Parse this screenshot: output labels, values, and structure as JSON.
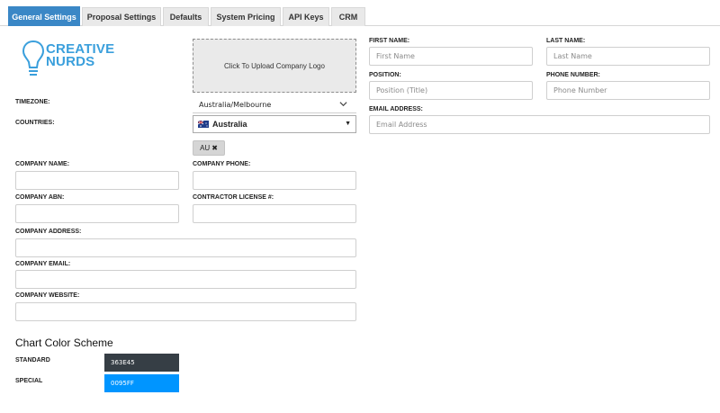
{
  "tabs": [
    {
      "label": "General Settings",
      "active": true
    },
    {
      "label": "Proposal Settings",
      "active": false
    },
    {
      "label": "Defaults",
      "active": false
    },
    {
      "label": "System Pricing",
      "active": false
    },
    {
      "label": "API Keys",
      "active": false
    },
    {
      "label": "CRM",
      "active": false
    }
  ],
  "logo": {
    "line1": "CREATIVE",
    "line2": "NURDS",
    "color": "#3a9fdc"
  },
  "upload_label": "Click To Upload Company Logo",
  "timezone": {
    "label": "TIMEZONE:",
    "value": "Australia/Melbourne"
  },
  "countries": {
    "label": "COUNTRIES:",
    "value": "Australia",
    "chips": [
      "AU"
    ]
  },
  "company": {
    "name_label": "COMPANY NAME:",
    "phone_label": "COMPANY PHONE:",
    "abn_label": "COMPANY ABN:",
    "license_label": "CONTRACTOR LICENSE #:",
    "address_label": "COMPANY ADDRESS:",
    "email_label": "COMPANY EMAIL:",
    "website_label": "COMPANY WEBSITE:"
  },
  "contact": {
    "first_name": {
      "label": "FIRST NAME:",
      "placeholder": "First Name"
    },
    "last_name": {
      "label": "LAST NAME:",
      "placeholder": "Last Name"
    },
    "position": {
      "label": "POSITION:",
      "placeholder": "Position (Title)"
    },
    "phone": {
      "label": "PHONE NUMBER:",
      "placeholder": "Phone Number"
    },
    "email": {
      "label": "EMAIL ADDRESS:",
      "placeholder": "Email Address"
    }
  },
  "chart_colors": {
    "title": "Chart Color Scheme",
    "standard": {
      "label": "STANDARD",
      "value": "363E45",
      "color": "#363e45"
    },
    "special": {
      "label": "SPECIAL",
      "value": "0095FF",
      "color": "#0095ff"
    }
  },
  "accent": "#3a87c6"
}
